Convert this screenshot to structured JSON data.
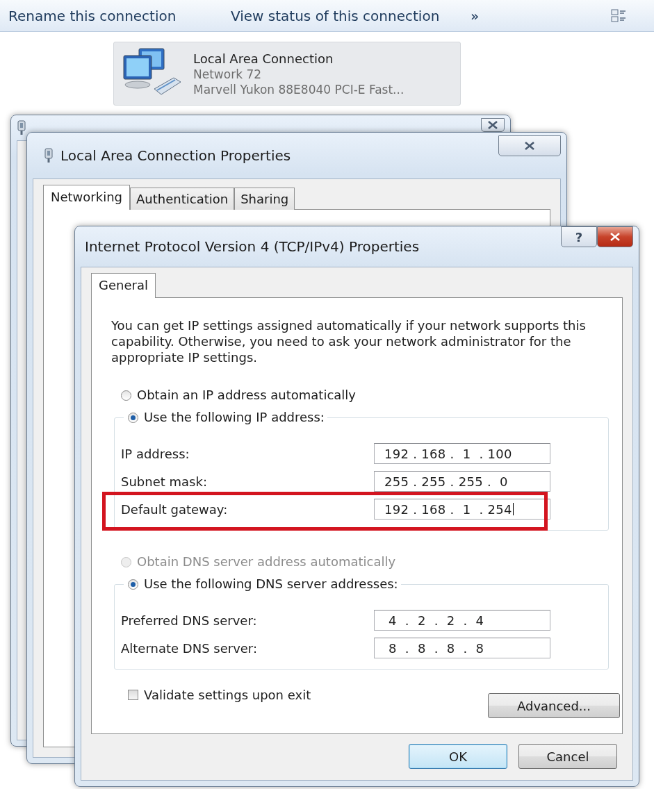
{
  "toolbar": {
    "items": [
      "Rename this connection",
      "View status of this connection"
    ],
    "more": "»"
  },
  "connection": {
    "name": "Local Area Connection",
    "network": "Network  72",
    "adapter": "Marvell Yukon 88E8040 PCI-E Fast..."
  },
  "properties_window": {
    "title": "Local Area Connection Properties",
    "tabs": [
      {
        "label": "Networking",
        "selected": true
      },
      {
        "label": "Authentication",
        "selected": false
      },
      {
        "label": "Sharing",
        "selected": false
      }
    ]
  },
  "ipv4_dialog": {
    "title": "Internet Protocol Version 4 (TCP/IPv4) Properties",
    "help": "?",
    "tabs": [
      {
        "label": "General",
        "selected": true
      }
    ],
    "description": "You can get IP settings assigned automatically if your network supports this capability. Otherwise, you need to ask your network administrator for the appropriate IP settings.",
    "ip_mode": [
      {
        "label": "Obtain an IP address automatically",
        "selected": false,
        "disabled": false
      },
      {
        "label": "Use the following IP address:",
        "selected": true,
        "disabled": false
      }
    ],
    "ip_fields": [
      {
        "label": "IP address:",
        "value": "192 . 168 .  1  . 100",
        "highlighted": false,
        "focused": false
      },
      {
        "label": "Subnet mask:",
        "value": "255 . 255 . 255 .  0",
        "highlighted": false,
        "focused": false
      },
      {
        "label": "Default gateway:",
        "value": "192 . 168 .  1  . 254",
        "highlighted": true,
        "focused": true
      }
    ],
    "dns_mode": [
      {
        "label": "Obtain DNS server address automatically",
        "selected": false,
        "disabled": true
      },
      {
        "label": "Use the following DNS server addresses:",
        "selected": true,
        "disabled": false
      }
    ],
    "dns_fields": [
      {
        "label": "Preferred DNS server:",
        "value": " 4  .  2  .  2  .  4",
        "highlighted": false,
        "focused": false
      },
      {
        "label": "Alternate DNS server:",
        "value": " 8  .  8  .  8  .  8",
        "highlighted": false,
        "focused": false
      }
    ],
    "validate": {
      "label": "Validate settings upon exit",
      "checked": false
    },
    "advanced": "Advanced...",
    "buttons": [
      {
        "label": "OK",
        "default": true
      },
      {
        "label": "Cancel",
        "default": false
      }
    ]
  }
}
